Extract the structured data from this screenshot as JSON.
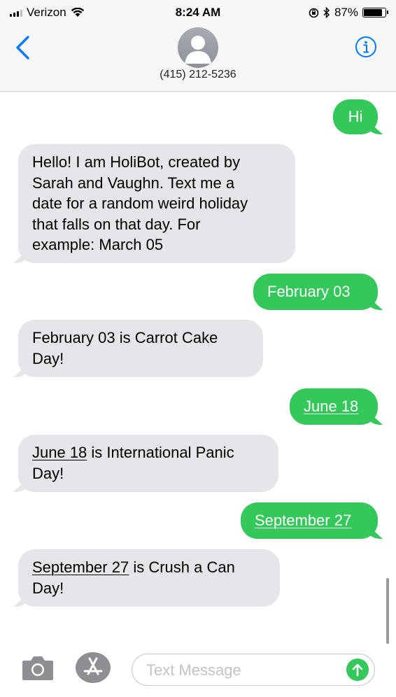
{
  "status_bar": {
    "carrier": "Verizon",
    "time": "8:24 AM",
    "battery": "87%"
  },
  "header": {
    "contact": "(415) 212-5236"
  },
  "messages": [
    {
      "direction": "out",
      "text": "Hi"
    },
    {
      "direction": "in",
      "lines": [
        "Hello! I am HoliBot, created by",
        "Sarah and Vaughn. Text me a",
        "date for a random weird holiday",
        "that falls on that day. For",
        "example: March 05"
      ]
    },
    {
      "direction": "out",
      "text": "February 03"
    },
    {
      "direction": "in",
      "lines": [
        "February 03 is Carrot Cake",
        "Day!"
      ]
    },
    {
      "direction": "out",
      "text": "June 18"
    },
    {
      "direction": "in",
      "link": "June 18",
      "rest": " is International Panic",
      "line2": "Day!"
    },
    {
      "direction": "out",
      "text": "September 27"
    },
    {
      "direction": "in",
      "link": "September 27",
      "rest": " is Crush a Can",
      "line2": "Day!"
    }
  ],
  "input": {
    "placeholder": "Text Message"
  },
  "colors": {
    "outgoing": "#34c759",
    "incoming": "#e5e5ea",
    "accent": "#007aff"
  },
  "icons": [
    "signal-icon",
    "wifi-icon",
    "orientation-lock-icon",
    "bluetooth-icon",
    "battery-icon",
    "back-chevron-icon",
    "avatar-icon",
    "info-icon",
    "camera-icon",
    "app-store-icon",
    "send-arrow-icon"
  ]
}
